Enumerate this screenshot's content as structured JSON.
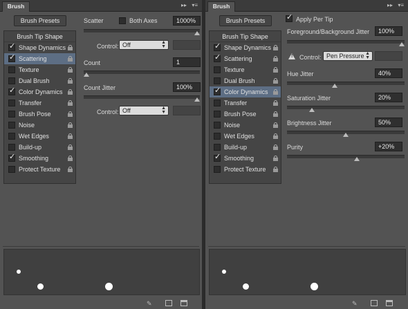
{
  "left": {
    "tab": "Brush",
    "presets_label": "Brush Presets",
    "tip_shape": "Brush Tip Shape",
    "options": [
      {
        "label": "Shape Dynamics",
        "checked": true,
        "selected": false
      },
      {
        "label": "Scattering",
        "checked": true,
        "selected": true
      },
      {
        "label": "Texture",
        "checked": false,
        "selected": false
      },
      {
        "label": "Dual Brush",
        "checked": false,
        "selected": false
      },
      {
        "label": "Color Dynamics",
        "checked": true,
        "selected": false
      },
      {
        "label": "Transfer",
        "checked": false,
        "selected": false
      },
      {
        "label": "Brush Pose",
        "checked": false,
        "selected": false
      },
      {
        "label": "Noise",
        "checked": false,
        "selected": false
      },
      {
        "label": "Wet Edges",
        "checked": false,
        "selected": false
      },
      {
        "label": "Build-up",
        "checked": false,
        "selected": false
      },
      {
        "label": "Smoothing",
        "checked": true,
        "selected": false
      },
      {
        "label": "Protect Texture",
        "checked": false,
        "selected": false
      }
    ],
    "scatter": {
      "label": "Scatter",
      "both_axes": "Both Axes",
      "value": "1000%",
      "slider": 1.0
    },
    "control1": {
      "label": "Control:",
      "value": "Off"
    },
    "count": {
      "label": "Count",
      "value": "1",
      "slider": 0.0
    },
    "count_jitter": {
      "label": "Count Jitter",
      "value": "100%",
      "slider": 1.0
    },
    "control2": {
      "label": "Control:",
      "value": "Off"
    }
  },
  "right": {
    "tab": "Brush",
    "presets_label": "Brush Presets",
    "tip_shape": "Brush Tip Shape",
    "options": [
      {
        "label": "Shape Dynamics",
        "checked": true,
        "selected": false
      },
      {
        "label": "Scattering",
        "checked": true,
        "selected": false
      },
      {
        "label": "Texture",
        "checked": false,
        "selected": false
      },
      {
        "label": "Dual Brush",
        "checked": false,
        "selected": false
      },
      {
        "label": "Color Dynamics",
        "checked": true,
        "selected": true
      },
      {
        "label": "Transfer",
        "checked": false,
        "selected": false
      },
      {
        "label": "Brush Pose",
        "checked": false,
        "selected": false
      },
      {
        "label": "Noise",
        "checked": false,
        "selected": false
      },
      {
        "label": "Wet Edges",
        "checked": false,
        "selected": false
      },
      {
        "label": "Build-up",
        "checked": false,
        "selected": false
      },
      {
        "label": "Smoothing",
        "checked": true,
        "selected": false
      },
      {
        "label": "Protect Texture",
        "checked": false,
        "selected": false
      }
    ],
    "apply_per_tip": "Apply Per Tip",
    "fg_bg_jitter": {
      "label": "Foreground/Background Jitter",
      "value": "100%",
      "slider": 1.0
    },
    "control": {
      "label": "Control:",
      "value": "Pen Pressure"
    },
    "hue_jitter": {
      "label": "Hue Jitter",
      "value": "40%",
      "slider": 0.4
    },
    "saturation_jitter": {
      "label": "Saturation Jitter",
      "value": "20%",
      "slider": 0.2
    },
    "brightness_jitter": {
      "label": "Brightness Jitter",
      "value": "50%",
      "slider": 0.5
    },
    "purity": {
      "label": "Purity",
      "value": "+20%",
      "slider": 0.6
    }
  },
  "colors": {
    "selected_row": "#5d6e84",
    "panel": "#535353",
    "field": "#2f2f2f"
  }
}
